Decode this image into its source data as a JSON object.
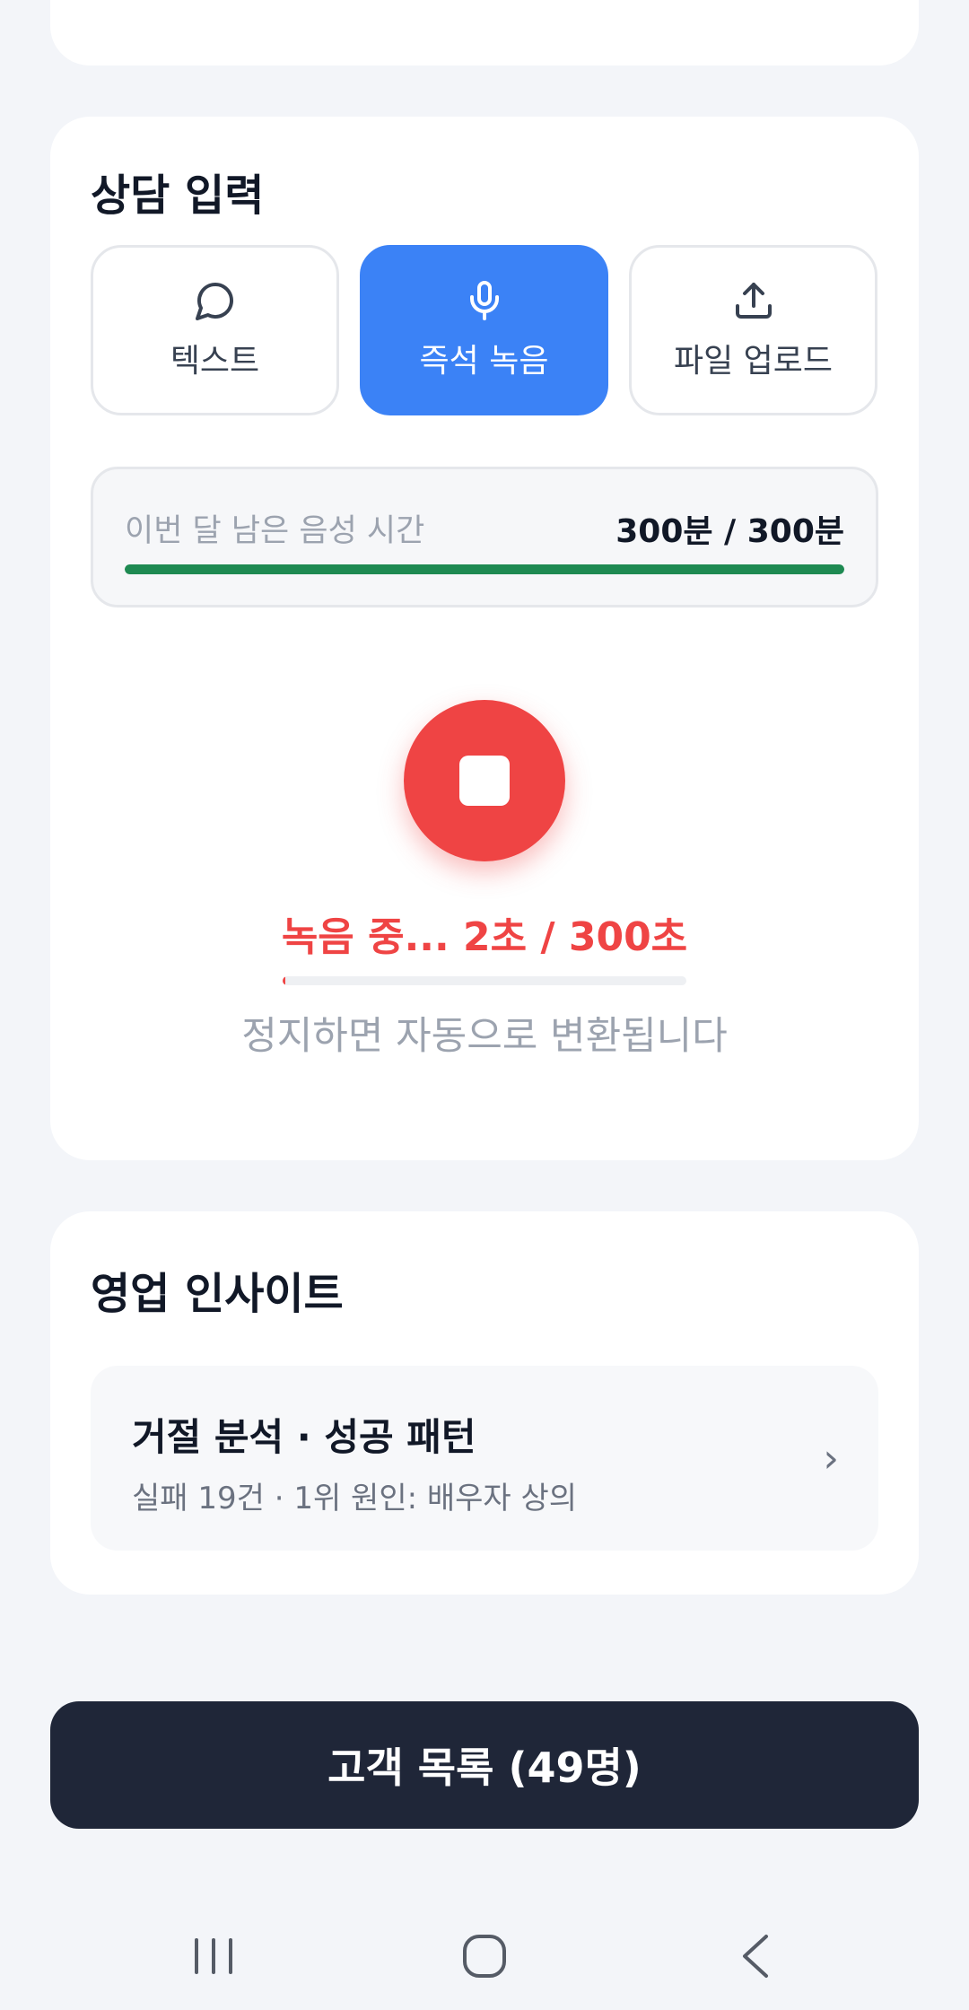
{
  "input_section": {
    "title": "상담 입력",
    "modes": [
      {
        "label": "텍스트",
        "icon": "chat-bubble-icon",
        "active": false
      },
      {
        "label": "즉석 녹음",
        "icon": "microphone-icon",
        "active": true
      },
      {
        "label": "파일 업로드",
        "icon": "upload-icon",
        "active": false
      }
    ],
    "quota": {
      "label": "이번 달 남은 음성 시간",
      "value": "300분 / 300분",
      "remaining_fraction": 1.0,
      "color": "#1e8a52"
    },
    "recording": {
      "status": "녹음 중... 2초 / 300초",
      "progress_fraction": 0.0067,
      "hint": "정지하면 자동으로 변환됩니다",
      "color": "#ef4444"
    }
  },
  "insight_section": {
    "title": "영업 인사이트",
    "item": {
      "title": "거절 분석 · 성공 패턴",
      "subtitle": "실패 19건 · 1위 원인: 배우자 상의",
      "chevron": "›"
    }
  },
  "cta": {
    "label": "고객 목록 (49명)",
    "color": "#1f2638"
  },
  "accent_color": "#3b82f6",
  "navbar": {
    "icons": [
      "recent-apps-icon",
      "home-icon",
      "back-icon"
    ]
  }
}
